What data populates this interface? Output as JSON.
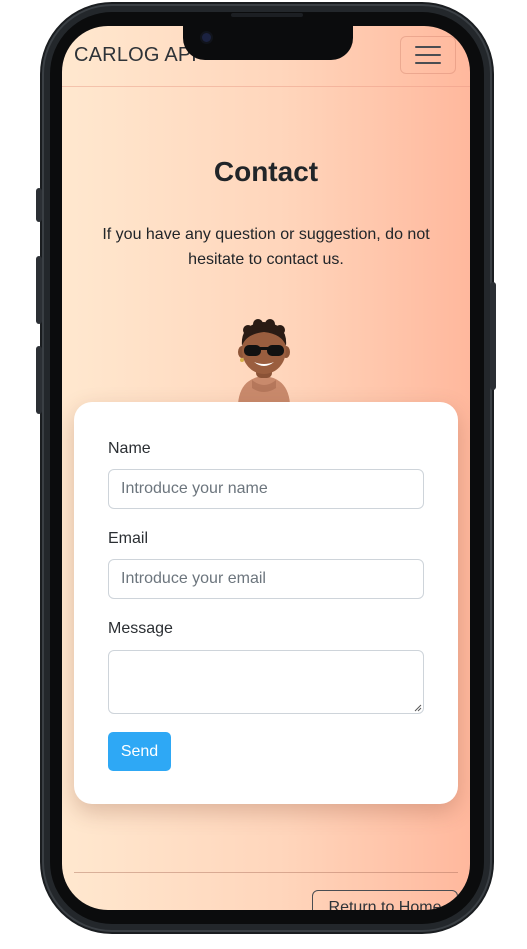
{
  "navbar": {
    "brand": "CARLOG APP",
    "menu_icon": "hamburger-menu-icon"
  },
  "hero": {
    "title": "Contact",
    "subtitle": "If you have any question or suggestion, do not hesitate to contact us.",
    "avatar_icon": "avatar-with-sunglasses"
  },
  "form": {
    "name_label": "Name",
    "name_placeholder": "Introduce your name",
    "name_value": "",
    "email_label": "Email",
    "email_placeholder": "Introduce your email",
    "email_value": "",
    "message_label": "Message",
    "message_value": "",
    "send_label": "Send"
  },
  "footer": {
    "home_button": "Return to Home"
  },
  "colors": {
    "gradient_left": "#ffe8cf",
    "gradient_right": "#ffb89d",
    "send_button": "#2ea8f5",
    "phone_frame": "#23272b"
  }
}
